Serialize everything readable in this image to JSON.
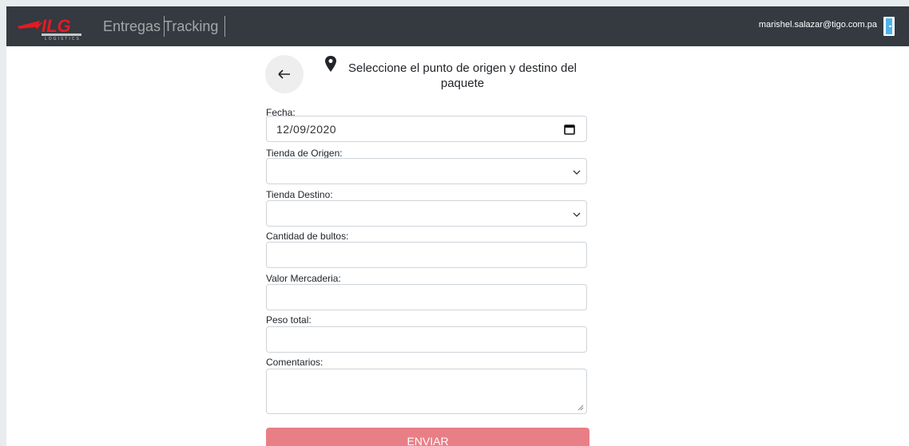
{
  "navbar": {
    "logo_text": "ILG",
    "logo_sub": "LOGISTICS",
    "links": [
      "Entregas",
      "Tracking"
    ],
    "user_email": "marishel.salazar@tigo.com.pa",
    "bg_color": "#343a40",
    "logo_color": "#e31b23"
  },
  "header": {
    "title": "Seleccione el punto de origen y destino del paquete"
  },
  "form": {
    "fecha": {
      "label": "Fecha:",
      "value": "12/09/2020"
    },
    "tienda_origen": {
      "label": "Tienda de Origen:",
      "value": ""
    },
    "tienda_destino": {
      "label": "Tienda Destino:",
      "value": ""
    },
    "cantidad_bultos": {
      "label": "Cantidad de bultos:",
      "value": ""
    },
    "valor_mercaderia": {
      "label": "Valor Mercaderia:",
      "value": ""
    },
    "peso_total": {
      "label": "Peso total:",
      "value": ""
    },
    "comentarios": {
      "label": "Comentarios:",
      "value": ""
    },
    "submit_label": "ENVIAR",
    "submit_color": "#e97f86"
  },
  "icons": [
    "back-arrow-icon",
    "map-pin-icon",
    "calendar-icon",
    "chevron-down-icon",
    "logout-door-icon"
  ]
}
